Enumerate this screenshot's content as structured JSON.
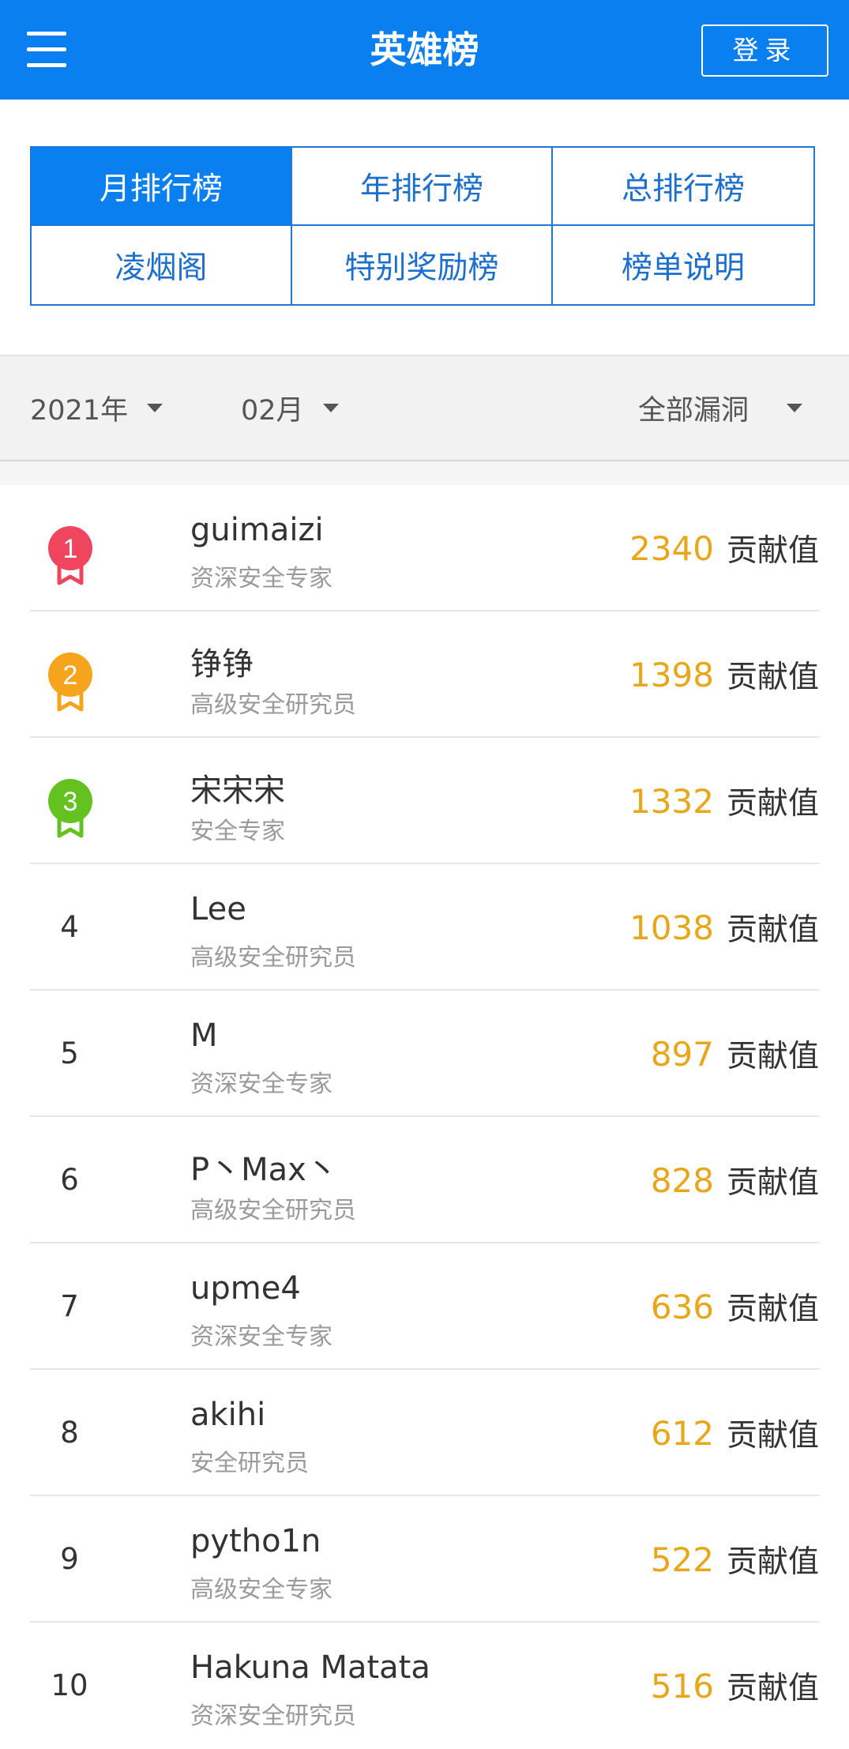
{
  "header": {
    "title": "英雄榜",
    "login_label": "登录"
  },
  "tabs": [
    {
      "label": "月排行榜",
      "active": true
    },
    {
      "label": "年排行榜",
      "active": false
    },
    {
      "label": "总排行榜",
      "active": false
    },
    {
      "label": "凌烟阁",
      "active": false
    },
    {
      "label": "特别奖励榜",
      "active": false
    },
    {
      "label": "榜单说明",
      "active": false
    }
  ],
  "filters": {
    "year": "2021年",
    "month": "02月",
    "category": "全部漏洞"
  },
  "score_unit": "贡献值",
  "colors": {
    "primary": "#0a7ff0",
    "score": "#eaa619",
    "medal_gold": "#f0455f",
    "medal_silver": "#f5a41c",
    "medal_bronze": "#63c21f"
  },
  "ranking": [
    {
      "rank": "1",
      "name": "guimaizi",
      "title": "资深安全专家",
      "score": "2340"
    },
    {
      "rank": "2",
      "name": "铮铮",
      "title": "高级安全研究员",
      "score": "1398"
    },
    {
      "rank": "3",
      "name": "宋宋宋",
      "title": "安全专家",
      "score": "1332"
    },
    {
      "rank": "4",
      "name": "Lee",
      "title": "高级安全研究员",
      "score": "1038"
    },
    {
      "rank": "5",
      "name": "M",
      "title": "资深安全专家",
      "score": "897"
    },
    {
      "rank": "6",
      "name": "P丶Max丶",
      "title": "高级安全研究员",
      "score": "828"
    },
    {
      "rank": "7",
      "name": "upme4",
      "title": "资深安全专家",
      "score": "636"
    },
    {
      "rank": "8",
      "name": "akihi",
      "title": "安全研究员",
      "score": "612"
    },
    {
      "rank": "9",
      "name": "pytho1n",
      "title": "高级安全专家",
      "score": "522"
    },
    {
      "rank": "10",
      "name": "Hakuna Matata",
      "title": "资深安全研究员",
      "score": "516"
    }
  ]
}
